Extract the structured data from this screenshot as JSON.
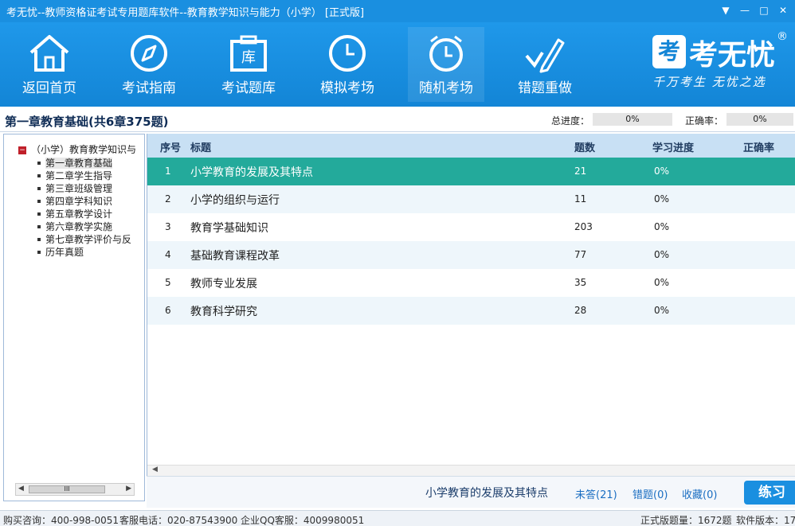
{
  "window": {
    "title": "考无忧--教师资格证考试专用题库软件--教育教学知识与能力（小学） [正式版]",
    "controls": [
      "▼",
      "—",
      "□",
      "✕"
    ]
  },
  "nav": [
    {
      "label": "返回首页",
      "icon": "home-icon"
    },
    {
      "label": "考试指南",
      "icon": "compass-icon"
    },
    {
      "label": "考试题库",
      "icon": "question-bank-icon"
    },
    {
      "label": "模拟考场",
      "icon": "clock-icon"
    },
    {
      "label": "随机考场",
      "icon": "alarm-clock-icon"
    },
    {
      "label": "错题重做",
      "icon": "pencil-check-icon"
    }
  ],
  "logo": {
    "mark": "考",
    "brand": "考无忧",
    "reg": "®",
    "slogan": "千万考生  无忧之选"
  },
  "info": {
    "chapter_title": "第一章教育基础(共6章375题)",
    "total_progress_label": "总进度：",
    "total_progress_value": "0%",
    "accuracy_label": "正确率：",
    "accuracy_value": "0%"
  },
  "tree": {
    "root": "（小学）教育教学知识与",
    "items": [
      "第一章教育基础",
      "第二章学生指导",
      "第三章班级管理",
      "第四章学科知识",
      "第五章教学设计",
      "第六章教学实施",
      "第七章教学评价与反",
      "历年真题"
    ],
    "scroll_thumb": "III"
  },
  "table": {
    "headers": {
      "idx": "序号",
      "title": "标题",
      "count": "题数",
      "progress": "学习进度",
      "accuracy": "正确率"
    },
    "rows": [
      {
        "idx": "1",
        "title": "小学教育的发展及其特点",
        "count": "21",
        "progress": "0%"
      },
      {
        "idx": "2",
        "title": "小学的组织与运行",
        "count": "11",
        "progress": "0%"
      },
      {
        "idx": "3",
        "title": "教育学基础知识",
        "count": "203",
        "progress": "0%"
      },
      {
        "idx": "4",
        "title": "基础教育课程改革",
        "count": "77",
        "progress": "0%"
      },
      {
        "idx": "5",
        "title": "教师专业发展",
        "count": "35",
        "progress": "0%"
      },
      {
        "idx": "6",
        "title": "教育科学研究",
        "count": "28",
        "progress": "0%"
      }
    ]
  },
  "actions": {
    "current": "小学教育的发展及其特点",
    "unanswered": "未答(21)",
    "wrong": "错题(0)",
    "favorites": "收藏(0)",
    "practice": "练习"
  },
  "status": {
    "purchase": "购买咨询：400-998-0051",
    "service": "客服电话：020-87543900",
    "qq": "企业QQ客服：4009980051",
    "questions": "正式版题量：1672题",
    "version": "软件版本：17"
  },
  "colors": {
    "accent": "#1a8fe0",
    "selected_row": "#23aa9b",
    "header": "#c8e0f4"
  }
}
